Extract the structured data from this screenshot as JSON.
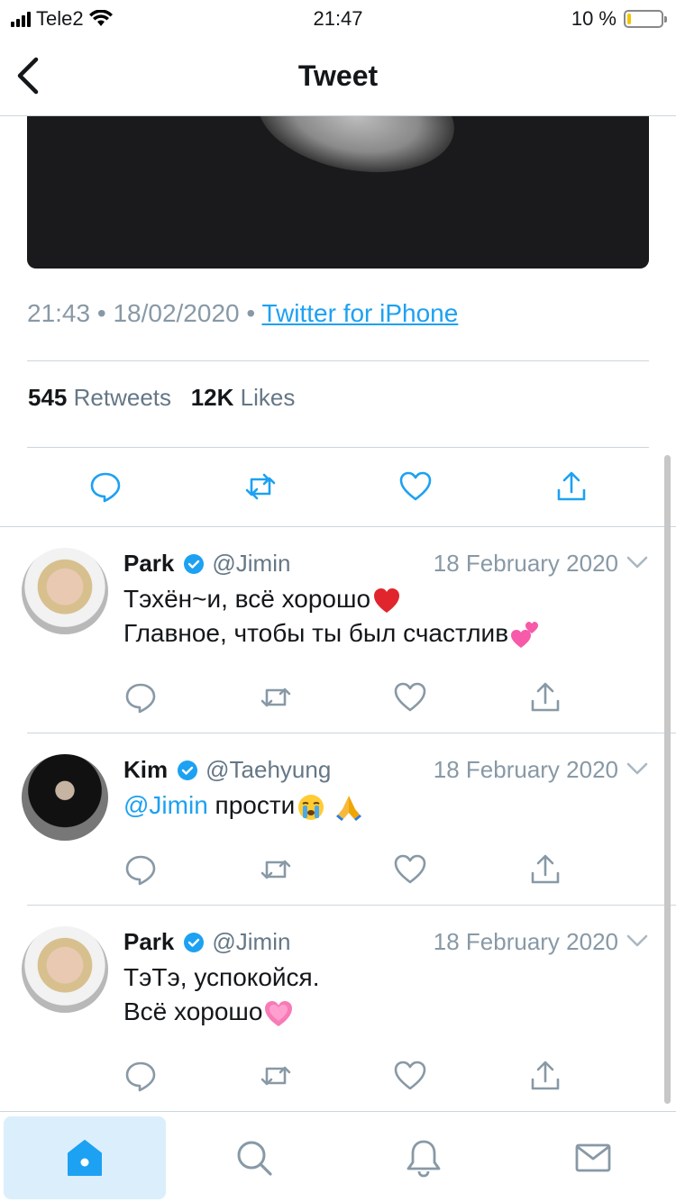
{
  "status_bar": {
    "carrier": "Tele2",
    "time": "21:47",
    "battery": "10 %",
    "battery_level": 0.1
  },
  "nav": {
    "title": "Tweet"
  },
  "tweet": {
    "time": "21:43",
    "date": "18/02/2020",
    "source": "Twitter for iPhone",
    "retweets_count": "545",
    "retweets_label": "Retweets",
    "likes_count": "12K",
    "likes_label": "Likes"
  },
  "replies": [
    {
      "name": "Park",
      "handle": "@Jimin",
      "date": "18 February 2020",
      "lines": [
        "Тэхён~и, всё хорошо",
        "Главное, чтобы ты был счастлив"
      ],
      "emojis": [
        "red-heart",
        "two-hearts"
      ]
    },
    {
      "name": "Kim",
      "handle": "@Taehyung",
      "date": "18 February 2020",
      "mention": "@Jimin",
      "text": "прости",
      "emojis": [
        "loudly-crying-face",
        "folded-hands"
      ]
    },
    {
      "name": "Park",
      "handle": "@Jimin",
      "date": "18 February 2020",
      "lines": [
        "ТэТэ, успокойся.",
        "Всё хорошо"
      ],
      "emojis": [
        "growing-heart"
      ]
    }
  ],
  "tab_bar": {
    "tabs": [
      "home-icon",
      "search-icon",
      "notifications-icon",
      "messages-icon"
    ],
    "active": "home-icon"
  },
  "colors": {
    "accent": "#1da1f2",
    "muted": "#8899a6",
    "divider": "#ccd6dd",
    "active_tab_bg": "#dbeefc"
  }
}
